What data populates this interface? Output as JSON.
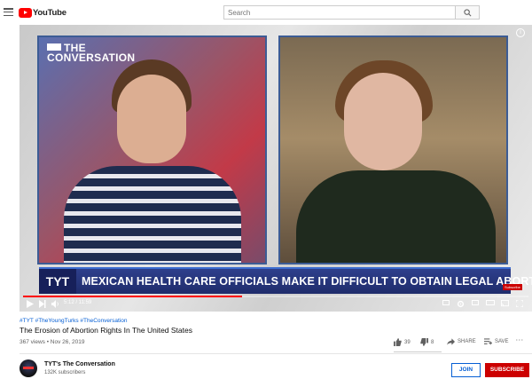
{
  "header": {
    "logo_text": "YouTube",
    "search_placeholder": "Search"
  },
  "video": {
    "overlay_logo_line1": "THE",
    "overlay_logo_line2": "CONVERSATION",
    "network_badge": "TYT",
    "headline": "MEXICAN HEALTH CARE OFFICIALS MAKE IT DIFFICULT TO OBTAIN LEGAL ABORTIONS",
    "time_display": "5:12 / 11:59",
    "progress_fraction": 0.434,
    "subscribe_watermark": "Subscribe"
  },
  "details": {
    "hashtags": "#TYT #TheYoungTurks #TheConversation",
    "title": "The Erosion of Abortion Rights In The United States",
    "views_date": "367 views • Nov 26, 2019",
    "likes": "39",
    "dislikes": "8",
    "share_label": "SHARE",
    "save_label": "SAVE"
  },
  "channel": {
    "name": "TYT's The Conversation",
    "subscribers": "132K subscribers",
    "join_label": "JOIN",
    "subscribe_label": "SUBSCRIBE"
  },
  "colors": {
    "brand_red": "#ff0000",
    "subscribe_red": "#cc0000",
    "link_blue": "#065fd4",
    "lower_third_blue": "#2e3f8c"
  }
}
